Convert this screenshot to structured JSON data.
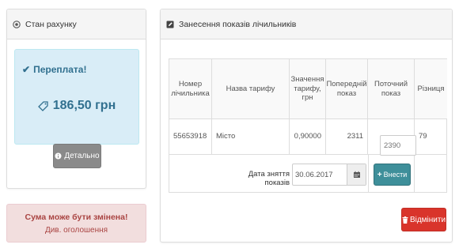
{
  "account": {
    "heading": "Стан рахунку",
    "overpay_label": "Переплата!",
    "amount": "186,50 грн",
    "details_button": "Детально"
  },
  "alert": {
    "title": "Сума може бути змінена!",
    "subtitle": "Див. оголошення"
  },
  "meters": {
    "heading": "Занесення показів лічильників",
    "columns": [
      "Номер лічильника",
      "Назва тарифу",
      "Значення тарифу, грн",
      "Попередній показ",
      "Поточний показ",
      "Різниця"
    ],
    "row": {
      "meter_number": "55653918",
      "tariff_name": "Місто",
      "tariff_value": "0,90000",
      "previous": "2311",
      "current_placeholder": "2390",
      "difference": "79"
    },
    "date_label": "Дата зняття показів",
    "date_value": "30.06.2017",
    "enter_button": "Внести",
    "cancel_button": "Відмінити"
  },
  "colors": {
    "info_bg": "#d9edf7",
    "info_text": "#31708f",
    "danger_bg": "#f2dede",
    "danger_text": "#a94442",
    "teal_button": "#3e8f9a",
    "red_button": "#d9342b",
    "gray_button": "#8a8a8a"
  },
  "icons": {
    "account_heading": "eye-icon",
    "meters_heading": "edit-icon",
    "overpay": "check-icon",
    "amount": "tag-icon",
    "details": "info-icon",
    "date": "calendar-icon",
    "enter": "plus-icon",
    "cancel": "trash-icon"
  }
}
